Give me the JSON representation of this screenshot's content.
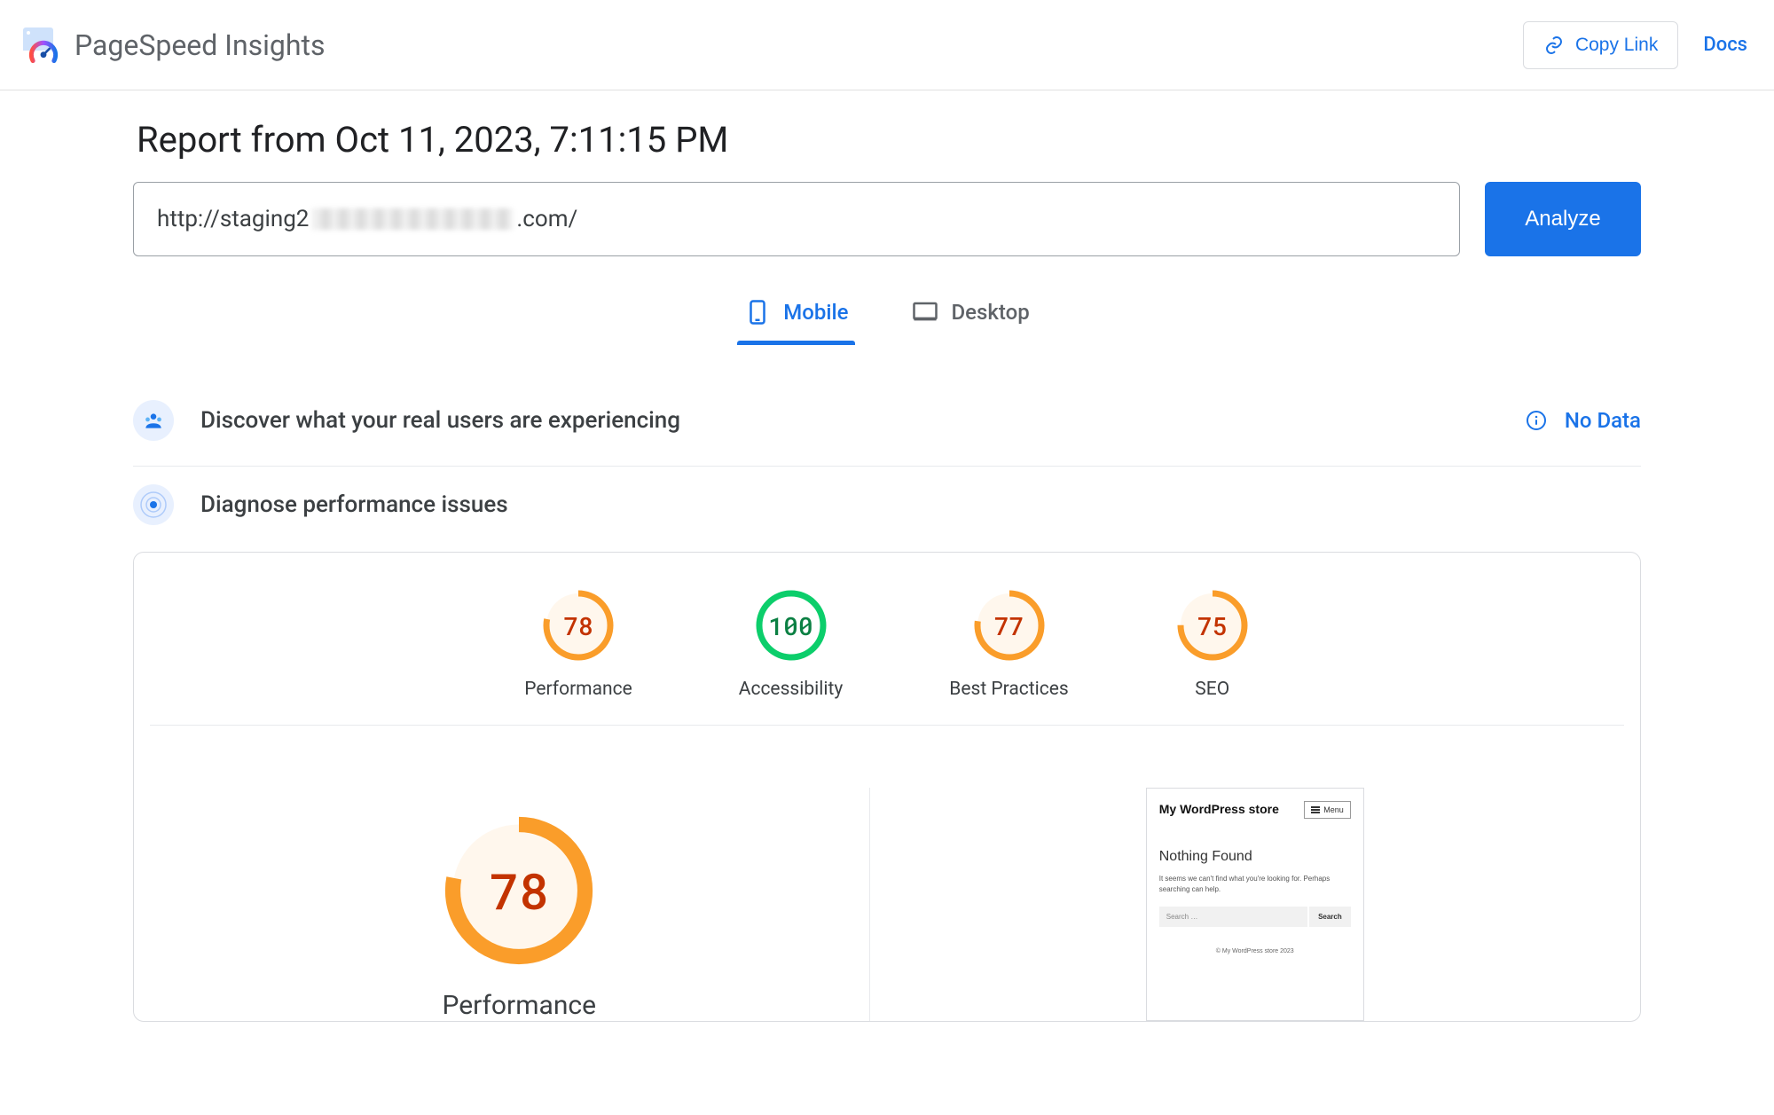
{
  "header": {
    "app_title": "PageSpeed Insights",
    "copy_link": "Copy Link",
    "docs": "Docs"
  },
  "report": {
    "title": "Report from Oct 11, 2023, 7:11:15 PM",
    "url_prefix": "http://staging2",
    "url_suffix": ".com/",
    "analyze": "Analyze"
  },
  "tabs": {
    "mobile": "Mobile",
    "desktop": "Desktop"
  },
  "sections": {
    "discover": "Discover what your real users are experiencing",
    "no_data": "No Data",
    "diagnose": "Diagnose performance issues"
  },
  "gauges": [
    {
      "label": "Performance",
      "score": 78,
      "color": "orange"
    },
    {
      "label": "Accessibility",
      "score": 100,
      "color": "green"
    },
    {
      "label": "Best Practices",
      "score": 77,
      "color": "orange"
    },
    {
      "label": "SEO",
      "score": 75,
      "color": "orange"
    }
  ],
  "detail": {
    "score": 78,
    "label": "Performance"
  },
  "preview": {
    "site_title": "My WordPress store",
    "menu": "Menu",
    "heading": "Nothing Found",
    "subtext": "It seems we can't find what you're looking for. Perhaps searching can help.",
    "search_placeholder": "Search …",
    "search_btn": "Search",
    "footer": "© My WordPress store 2023"
  },
  "colors": {
    "orange": "#fa9d2a",
    "orange_fill": "#fff7ed",
    "green": "#0cce6b",
    "green_fill": "#ffffff"
  }
}
